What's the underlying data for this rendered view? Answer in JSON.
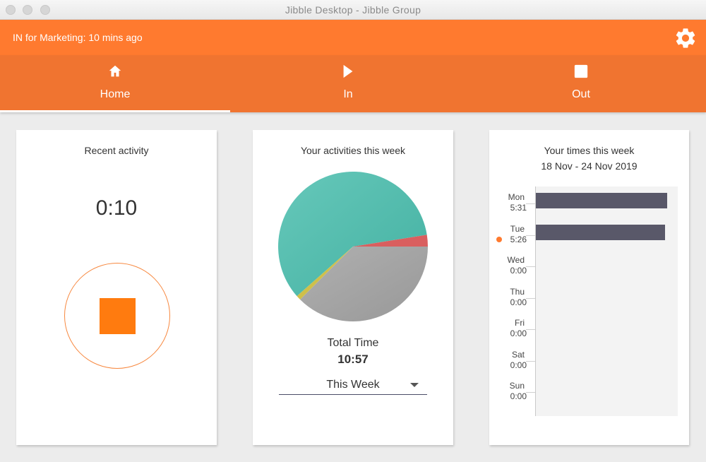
{
  "window": {
    "title": "Jibble Desktop - Jibble Group",
    "controls": [
      "close",
      "minimize",
      "maximize"
    ]
  },
  "status": {
    "text": "IN for Marketing: 10 mins ago",
    "settings_icon": "gear-icon"
  },
  "tabs": [
    {
      "label": "Home",
      "icon": "home-icon",
      "active": true
    },
    {
      "label": "In",
      "icon": "play-icon",
      "active": false
    },
    {
      "label": "Out",
      "icon": "stop-icon",
      "active": false
    }
  ],
  "recent": {
    "title": "Recent activity",
    "timer": "0:10",
    "stop_button_icon": "stop-icon"
  },
  "activities": {
    "title": "Your activities this week",
    "total_label": "Total Time",
    "total_value": "10:57",
    "period_selected": "This Week"
  },
  "times": {
    "title": "Your times this week",
    "range": "18 Nov - 24 Nov 2019"
  },
  "colors": {
    "accent": "#ff7a2f",
    "tab_bar": "#f07430",
    "bar": "#595869"
  },
  "chart_data": [
    {
      "type": "pie",
      "title": "Your activities this week",
      "total": "10:57",
      "slices": [
        {
          "name": "Activity (teal)",
          "share": 0.59,
          "color": "#4fbcad"
        },
        {
          "name": "Activity (red)",
          "share": 0.025,
          "color": "#d95f5f"
        },
        {
          "name": "Activity (gray)",
          "share": 0.375,
          "color": "#a6a6a6"
        },
        {
          "name": "Activity (yellow)",
          "share": 0.01,
          "color": "#cfc04a"
        }
      ],
      "slice_order_note": "clockwise from 3 o'clock: gray, yellow, teal, red"
    },
    {
      "type": "bar",
      "orientation": "horizontal",
      "title": "Your times this week",
      "subtitle": "18 Nov - 24 Nov 2019",
      "categories": [
        "Mon",
        "Tue",
        "Wed",
        "Thu",
        "Fri",
        "Sat",
        "Sun"
      ],
      "labels": [
        "5:31",
        "5:26",
        "0:00",
        "0:00",
        "0:00",
        "0:00",
        "0:00"
      ],
      "values_minutes": [
        331,
        326,
        0,
        0,
        0,
        0,
        0
      ],
      "xlim_minutes": [
        0,
        360
      ],
      "today": "Tue"
    }
  ]
}
